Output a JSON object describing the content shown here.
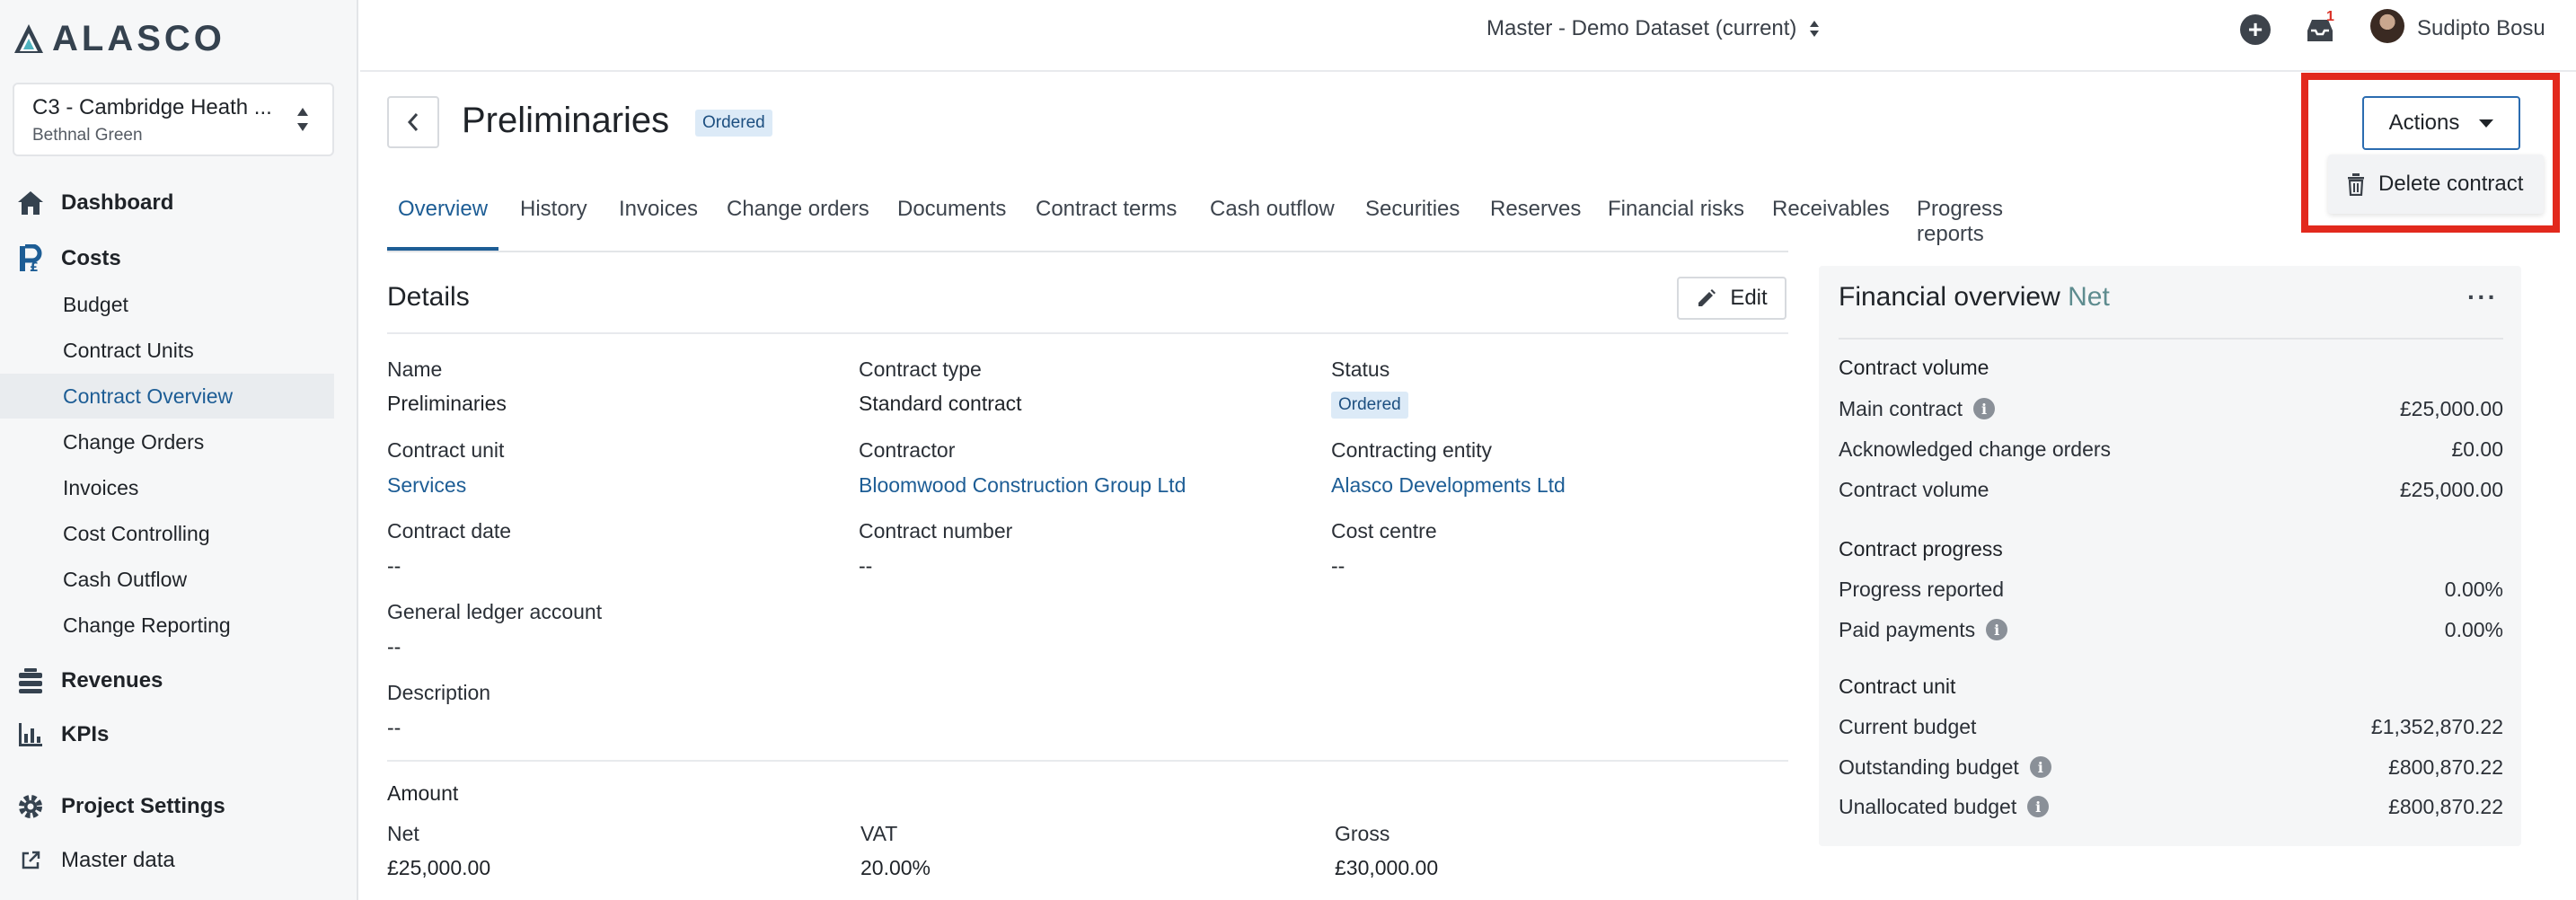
{
  "brand": {
    "name": "ALASCO"
  },
  "project": {
    "name": "C3 - Cambridge Heath ...",
    "location": "Bethnal Green"
  },
  "nav": {
    "dashboard": "Dashboard",
    "costs": "Costs",
    "costs_items": [
      "Budget",
      "Contract Units",
      "Contract Overview",
      "Change Orders",
      "Invoices",
      "Cost Controlling",
      "Cash Outflow",
      "Change Reporting"
    ],
    "revenues": "Revenues",
    "kpis": "KPIs",
    "project_settings": "Project Settings",
    "master_data": "Master data"
  },
  "topbar": {
    "dataset": "Master - Demo Dataset (current)",
    "inbox_count": "1",
    "user": "Sudipto Bosu"
  },
  "header": {
    "title": "Preliminaries",
    "status": "Ordered",
    "actions_label": "Actions",
    "delete_label": "Delete contract"
  },
  "tabs": [
    "Overview",
    "History",
    "Invoices",
    "Change orders",
    "Documents",
    "Contract terms",
    "Cash outflow",
    "Securities",
    "Reserves",
    "Financial risks",
    "Receivables",
    "Progress reports"
  ],
  "details": {
    "title": "Details",
    "edit_label": "Edit",
    "name_label": "Name",
    "name_value": "Preliminaries",
    "type_label": "Contract type",
    "type_value": "Standard contract",
    "status_label": "Status",
    "status_value": "Ordered",
    "unit_label": "Contract unit",
    "unit_value": "Services",
    "contractor_label": "Contractor",
    "contractor_value": "Bloomwood Construction Group Ltd",
    "entity_label": "Contracting entity",
    "entity_value": "Alasco Developments Ltd",
    "date_label": "Contract date",
    "date_value": "--",
    "number_label": "Contract number",
    "number_value": "--",
    "centre_label": "Cost centre",
    "centre_value": "--",
    "gl_label": "General ledger account",
    "gl_value": "--",
    "desc_label": "Description",
    "desc_value": "--"
  },
  "amount": {
    "title": "Amount",
    "net_label": "Net",
    "net_value": "£25,000.00",
    "vat_label": "VAT",
    "vat_value": "20.00%",
    "gross_label": "Gross",
    "gross_value": "£30,000.00"
  },
  "financial": {
    "title": "Financial overview",
    "subtitle": "Net",
    "volume_title": "Contract volume",
    "main_contract_label": "Main contract",
    "main_contract_value": "£25,000.00",
    "ack_label": "Acknowledged change orders",
    "ack_value": "£0.00",
    "volume_label": "Contract volume",
    "volume_value": "£25,000.00",
    "progress_title": "Contract progress",
    "reported_label": "Progress reported",
    "reported_value": "0.00%",
    "paid_label": "Paid payments",
    "paid_value": "0.00%",
    "unit_title": "Contract unit",
    "current_label": "Current budget",
    "current_value": "£1,352,870.22",
    "outstanding_label": "Outstanding budget",
    "outstanding_value": "£800,870.22",
    "unallocated_label": "Unallocated budget",
    "unallocated_value": "£800,870.22"
  }
}
